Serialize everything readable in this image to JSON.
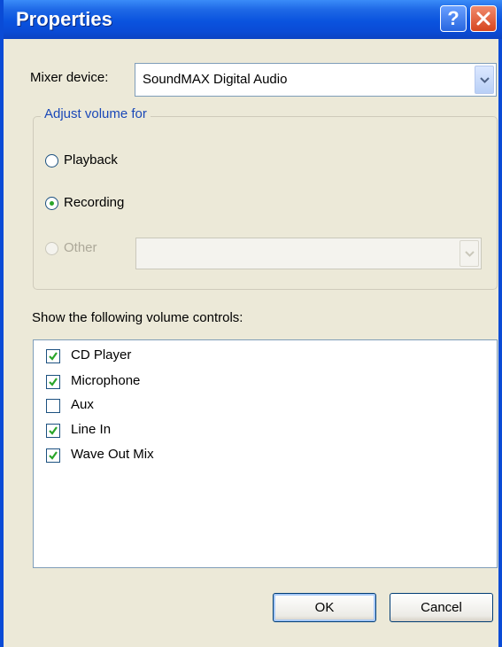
{
  "window": {
    "title": "Properties"
  },
  "titlebar": {
    "help_label": "?",
    "close_icon": "close-icon"
  },
  "mixer": {
    "label": "Mixer device:",
    "selected": "SoundMAX Digital Audio"
  },
  "adjust": {
    "group_label": "Adjust volume for",
    "options": [
      {
        "label": "Playback",
        "selected": false,
        "enabled": true
      },
      {
        "label": "Recording",
        "selected": true,
        "enabled": true
      },
      {
        "label": "Other",
        "selected": false,
        "enabled": false
      }
    ],
    "other_select_value": ""
  },
  "controls": {
    "label": "Show the following volume controls:",
    "items": [
      {
        "label": "CD Player",
        "checked": true
      },
      {
        "label": "Microphone",
        "checked": true
      },
      {
        "label": "Aux",
        "checked": false
      },
      {
        "label": "Line In",
        "checked": true
      },
      {
        "label": "Wave Out Mix",
        "checked": true
      }
    ]
  },
  "buttons": {
    "ok": "OK",
    "cancel": "Cancel"
  },
  "colors": {
    "titlebar": "#0a4bd6",
    "face": "#ece9d8",
    "check": "#2aa52a",
    "group_title": "#1a48b8"
  }
}
